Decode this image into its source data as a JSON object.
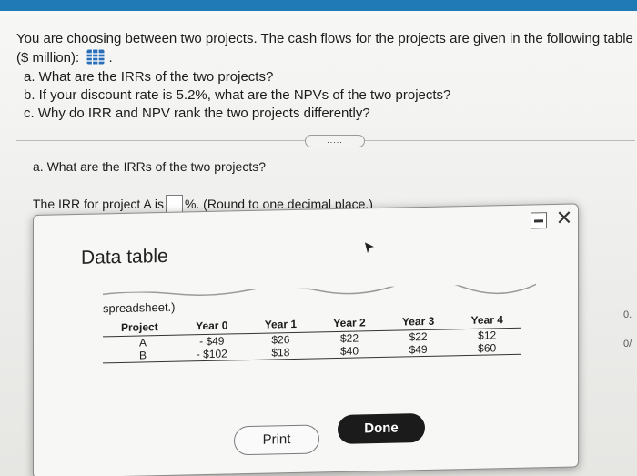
{
  "question": {
    "intro": "You are choosing between two projects. The cash flows for the projects are given in the following table ($ million):",
    "icon": "table-grid-icon",
    "icon_suffix": ".",
    "parts": [
      "a. What are the IRRs of the two projects?",
      "b. If your discount rate is 5.2%, what are the NPVs of the two projects?",
      "c. Why do IRR and NPV rank the two projects differently?"
    ],
    "more_button": "....."
  },
  "part_a": {
    "heading": "a. What are the IRRs of the two projects?",
    "irr_prefix": "The IRR for project A is",
    "irr_value": "",
    "irr_suffix": "%. (Round to one decimal place.)"
  },
  "modal": {
    "title": "Data table",
    "minimize_icon": "minimize-icon",
    "close_glyph": "✕",
    "spreadsheet_label": "spreadsheet.)",
    "table": {
      "headers": [
        "Project",
        "Year 0",
        "Year 1",
        "Year 2",
        "Year 3",
        "Year 4"
      ],
      "rows": [
        [
          "A",
          "- $49",
          "$26",
          "$22",
          "$22",
          "$12"
        ],
        [
          "B",
          "- $102",
          "$18",
          "$40",
          "$49",
          "$60"
        ]
      ]
    },
    "print_label": "Print",
    "done_label": "Done"
  },
  "edge": [
    "0.",
    "0/"
  ],
  "colors": {
    "topbar": "#1f7ab6",
    "icon_blue": "#2b6fb8",
    "done_bg": "#1b1b1b"
  }
}
